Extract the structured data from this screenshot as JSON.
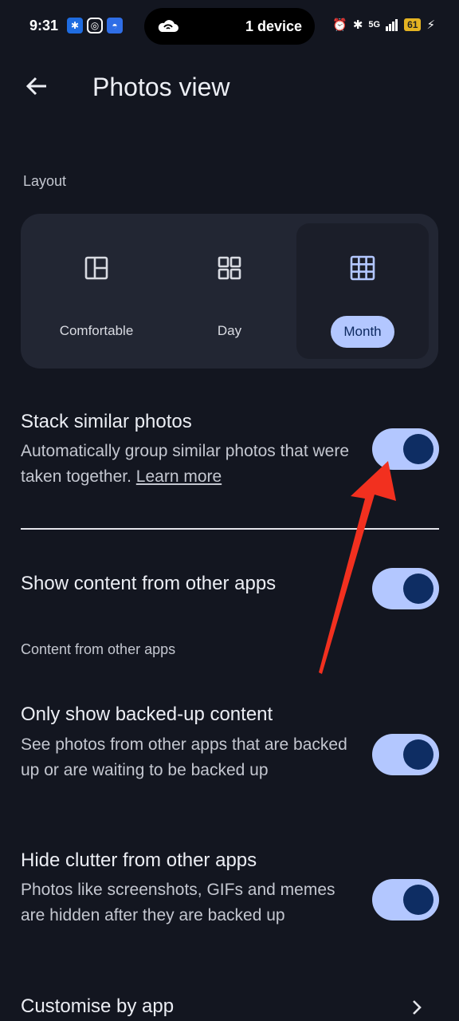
{
  "status_bar": {
    "time": "9:31",
    "pill_text": "1 device",
    "battery": "61",
    "network": "5G"
  },
  "header": {
    "title": "Photos view"
  },
  "layout": {
    "label": "Layout",
    "options": [
      {
        "label": "Comfortable",
        "selected": false
      },
      {
        "label": "Day",
        "selected": false
      },
      {
        "label": "Month",
        "selected": true
      }
    ]
  },
  "settings": {
    "stack": {
      "title": "Stack similar photos",
      "desc": "Automatically group similar photos that were taken together.",
      "link": "Learn more",
      "on": true
    },
    "other_apps": {
      "title": "Show content from other apps",
      "on": true
    },
    "subheader": "Content from other apps",
    "backed_up": {
      "title": "Only show backed-up content",
      "desc": "See photos from other apps that are backed up or are waiting to be backed up",
      "on": true
    },
    "clutter": {
      "title": "Hide clutter from other apps",
      "desc": "Photos like screenshots, GIFs and memes are hidden after they are backed up",
      "on": true
    },
    "customise": {
      "title": "Customise by app"
    }
  },
  "colors": {
    "background": "#131620",
    "accent": "#b3c7ff",
    "knob": "#0e2d63",
    "annotation_arrow": "#f2301f"
  }
}
